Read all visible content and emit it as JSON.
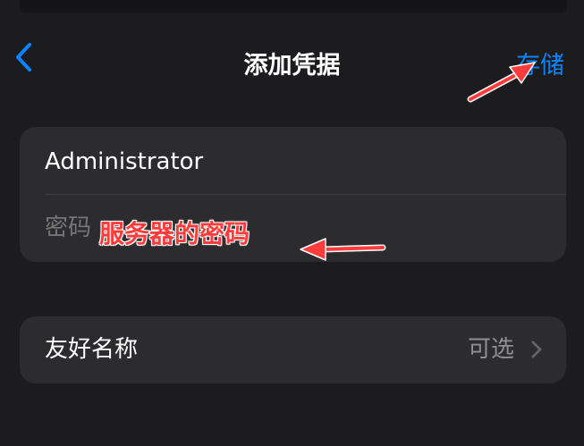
{
  "nav": {
    "title": "添加凭据",
    "save_label": "存储"
  },
  "credentials": {
    "username_value": "Administrator",
    "password_placeholder": "密码"
  },
  "friendly_name": {
    "label": "友好名称",
    "value": "可选"
  },
  "annotation": {
    "text": "服务器的密码",
    "color": "#ff3b3b"
  },
  "colors": {
    "accent": "#0a84ff",
    "background": "#1c1c1e",
    "group": "#2c2c2e"
  },
  "icons": {
    "back": "chevron-left-icon",
    "row": "chevron-right-icon"
  }
}
